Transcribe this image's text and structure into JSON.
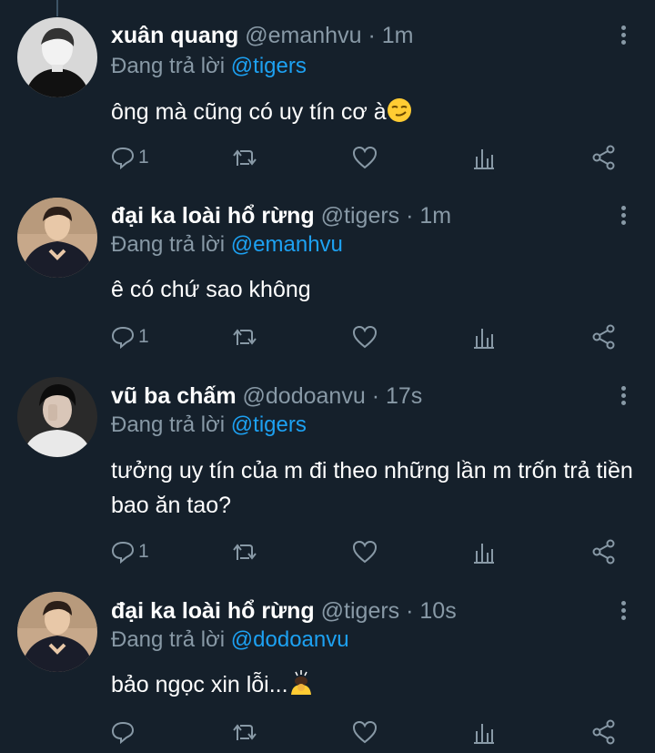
{
  "colors": {
    "background": "#15202b",
    "muted": "#8899a6",
    "accent": "#1da1f2",
    "text": "#ffffff"
  },
  "tweets": [
    {
      "name": "xuân quang",
      "handle": "@emanhvu",
      "dot": "·",
      "time": "1m",
      "reply_prefix": "Đang trả lời",
      "reply_to": "@tigers",
      "text": "ông mà cũng có uy tín cơ à",
      "emoji": "smirking-face",
      "reply_count": "1"
    },
    {
      "name": "đại ka loài hổ rừng",
      "handle": "@tigers",
      "dot": "·",
      "time": "1m",
      "reply_prefix": "Đang trả lời",
      "reply_to": "@emanhvu",
      "text": "ê có chứ sao không",
      "reply_count": "1"
    },
    {
      "name": "vũ ba chấm",
      "handle": "@dodoanvu",
      "dot": "·",
      "time": "17s",
      "reply_prefix": "Đang trả lời",
      "reply_to": "@tigers",
      "text": "tưởng uy tín của m đi theo những lần m trốn trả tiền bao ăn tao?",
      "reply_count": "1"
    },
    {
      "name": "đại ka loài hổ rừng",
      "handle": "@tigers",
      "dot": "·",
      "time": "10s",
      "reply_prefix": "Đang trả lời",
      "reply_to": "@dodoanvu",
      "text": "bảo ngọc xin lỗi...",
      "emoji": "bowing-person",
      "reply_count": ""
    }
  ],
  "icons": [
    "reply-icon",
    "retweet-icon",
    "like-icon",
    "analytics-icon",
    "share-icon",
    "more-icon"
  ]
}
